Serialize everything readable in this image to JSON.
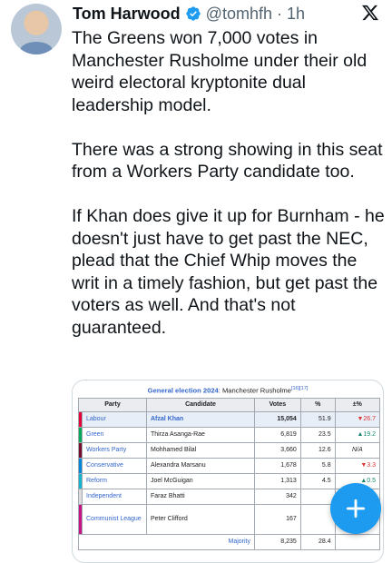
{
  "author": {
    "name": "Tom Harwood",
    "handle": "@tomhfh",
    "separator": "·",
    "time": "1h"
  },
  "tweet": {
    "paragraphs": [
      "The Greens won 7,000 votes in Manchester Rusholme under their old weird electoral kryptonite dual leadership model.",
      "There was a strong showing in this seat from a Workers Party candidate too.",
      "If Khan does give it up for Burnham - he doesn't just have to get past the NEC, plead that the Chief Whip moves the writ in a timely fashion, but get past the voters as well. And that's not guaranteed."
    ]
  },
  "media": {
    "caption_link": "General election 2024",
    "caption_rest": ": Manchester Rusholme",
    "caption_refs": "[16][17]",
    "headers": [
      "Party",
      "Candidate",
      "Votes",
      "%",
      "±%"
    ],
    "rows": [
      {
        "party": "Labour",
        "candidate": "Afzal Khan",
        "votes": "15,054",
        "pct": "51.9",
        "change": "▼26.7",
        "dir": "down",
        "color": "#e4003b"
      },
      {
        "party": "Green",
        "candidate": "Thirza Asanga-Rae",
        "votes": "6,819",
        "pct": "23.5",
        "change": "▲19.2",
        "dir": "up",
        "color": "#02a95b"
      },
      {
        "party": "Workers Party",
        "candidate": "Mohhamed Bilal",
        "votes": "3,660",
        "pct": "12.6",
        "change": "N/A",
        "dir": "na",
        "color": "#770d2c"
      },
      {
        "party": "Conservative",
        "candidate": "Alexandra Marsanu",
        "votes": "1,678",
        "pct": "5.8",
        "change": "▼3.3",
        "dir": "down",
        "color": "#0087dc"
      },
      {
        "party": "Reform",
        "candidate": "Joel McGuigan",
        "votes": "1,313",
        "pct": "4.5",
        "change": "▲0.5",
        "dir": "up",
        "color": "#12b6cf"
      },
      {
        "party": "Independent",
        "candidate": "Faraz Bhatti",
        "votes": "342",
        "pct": "",
        "change": "",
        "dir": "",
        "color": "#dcdcdc"
      },
      {
        "party": "Communist League",
        "candidate": "Peter Clifford",
        "votes": "167",
        "pct": "",
        "change": "",
        "dir": "",
        "color": "#c71585"
      }
    ],
    "majority": {
      "label": "Majority",
      "votes": "8,235",
      "pct": "28.4"
    }
  },
  "icons": {
    "verified": "verified-badge-icon",
    "x_logo": "x-logo-icon",
    "compose": "plus-icon"
  },
  "colors": {
    "verified": "#1d9bf0",
    "fab": "#1d9bf0"
  }
}
